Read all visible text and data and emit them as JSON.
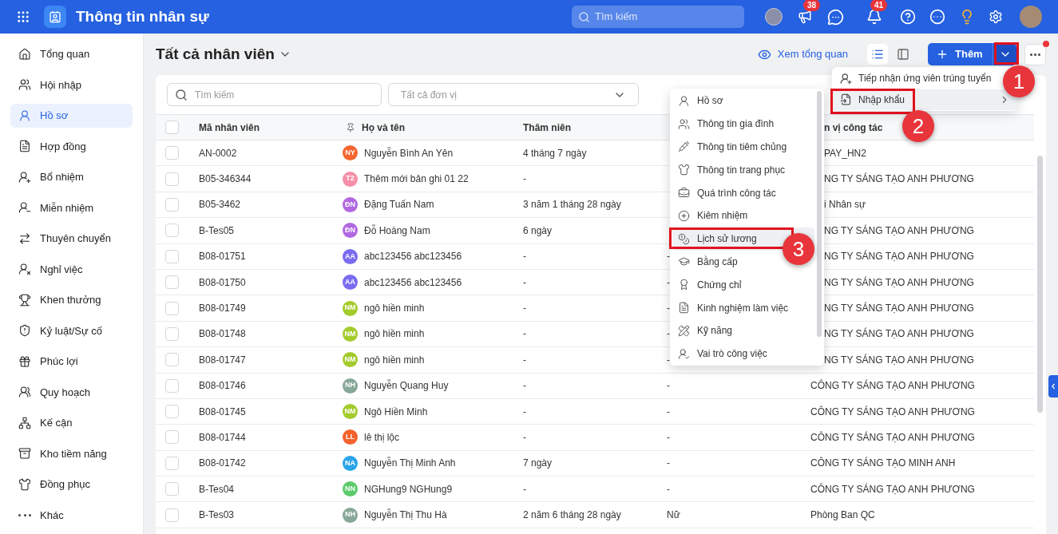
{
  "topbar": {
    "title": "Thông tin nhân sự",
    "search_placeholder": "Tìm kiếm",
    "badges": [
      {
        "count": "38"
      },
      {
        "count": "41"
      }
    ]
  },
  "sidebar": {
    "items": [
      {
        "label": "Tổng quan",
        "selected": false
      },
      {
        "label": "Hội nhập",
        "selected": false
      },
      {
        "label": "Hồ sơ",
        "selected": true
      },
      {
        "label": "Hợp đồng",
        "selected": false
      },
      {
        "label": "Bổ nhiệm",
        "selected": false
      },
      {
        "label": "Miễn nhiệm",
        "selected": false
      },
      {
        "label": "Thuyên chuyển",
        "selected": false
      },
      {
        "label": "Nghỉ việc",
        "selected": false
      },
      {
        "label": "Khen thưởng",
        "selected": false
      },
      {
        "label": "Kỷ luật/Sự cố",
        "selected": false
      },
      {
        "label": "Phúc lợi",
        "selected": false
      },
      {
        "label": "Quy hoạch",
        "selected": false
      },
      {
        "label": "Kế cận",
        "selected": false
      },
      {
        "label": "Kho tiềm năng",
        "selected": false
      },
      {
        "label": "Đồng phục",
        "selected": false
      },
      {
        "label": "Khác",
        "selected": false
      }
    ]
  },
  "header": {
    "title": "Tất cả nhân viên",
    "overview_link": "Xem tổng quan",
    "views": [
      {
        "kind": "list",
        "selected": true
      },
      {
        "kind": "panel",
        "selected": false
      }
    ],
    "add_button": "Thêm",
    "more_has_notification": true
  },
  "filters": {
    "search_placeholder": "Tìm kiếm",
    "unit_placeholder": "Tất cả đơn vị"
  },
  "table": {
    "header_checked": false,
    "columns": [
      "Mã nhân viên",
      "Họ và tên",
      "Thâm niên",
      "n vị công tác"
    ],
    "rows": [
      {
        "checked": false,
        "code": "AN-0002",
        "initials": "NY",
        "color": "#f5652f",
        "name": "Nguyễn Bình An Yên",
        "seniority": "4 tháng 7 ngày",
        "unit": "PAY_HN2"
      },
      {
        "checked": false,
        "code": "B05-346344",
        "initials": "T2",
        "color": "#f590a8",
        "name": "Thêm mới bản ghi 01 22",
        "seniority": "-",
        "unit": "NG TY SÁNG TẠO ANH PHƯƠNG"
      },
      {
        "checked": false,
        "code": "B05-3462",
        "initials": "ĐN",
        "color": "#b168e0",
        "name": "Đặng Tuấn Nam",
        "seniority": "3 năm 1 tháng 28 ngày",
        "unit": "i Nhân sự"
      },
      {
        "checked": false,
        "code": "B-Tes05",
        "initials": "ĐN",
        "color": "#b168e0",
        "name": "Đỗ Hoàng Nam",
        "seniority": "6 ngày",
        "unit": "NG TY SÁNG TẠO ANH PHƯƠNG"
      },
      {
        "checked": false,
        "code": "B08-01751",
        "initials": "AA",
        "color": "#7a6cf0",
        "name": "abc123456 abc123456",
        "seniority": "-",
        "column_4": "-",
        "unit": "NG TY SÁNG TẠO ANH PHƯƠNG"
      },
      {
        "checked": false,
        "code": "B08-01750",
        "initials": "AA",
        "color": "#7a6cf0",
        "name": "abc123456 abc123456",
        "seniority": "-",
        "column_4": "-",
        "unit": "NG TY SÁNG TẠO ANH PHƯƠNG"
      },
      {
        "checked": false,
        "code": "B08-01749",
        "initials": "NM",
        "color": "#a4cb2d",
        "name": "ngô hiền minh",
        "seniority": "-",
        "column_4": "-",
        "unit": "NG TY SÁNG TẠO ANH PHƯƠNG"
      },
      {
        "checked": false,
        "code": "B08-01748",
        "initials": "NM",
        "color": "#a4cb2d",
        "name": "ngô hiền minh",
        "seniority": "-",
        "column_4": "-",
        "unit": "NG TY SÁNG TẠO ANH PHƯƠNG"
      },
      {
        "checked": false,
        "code": "B08-01747",
        "initials": "NM",
        "color": "#a4cb2d",
        "name": "ngô hiền minh",
        "seniority": "-",
        "column_4": "-",
        "unit": "NG TY SÁNG TẠO ANH PHƯƠNG"
      },
      {
        "checked": false,
        "code": "B08-01746",
        "initials": "NH",
        "color": "#87a797",
        "name": "Nguyễn Quang Huy",
        "seniority": "-",
        "column_4": "-",
        "unit": "CÔNG TY SÁNG TẠO ANH PHƯƠNG"
      },
      {
        "checked": false,
        "code": "B08-01745",
        "initials": "NM",
        "color": "#a4cb2d",
        "name": "Ngô Hiền Minh",
        "seniority": "-",
        "column_4": "-",
        "unit": "CÔNG TY SÁNG TẠO ANH PHƯƠNG"
      },
      {
        "checked": false,
        "code": "B08-01744",
        "initials": "LL",
        "color": "#f4622c",
        "name": "lê thị lộc",
        "seniority": "-",
        "column_4": "-",
        "unit": "CÔNG TY SÁNG TẠO ANH PHƯƠNG"
      },
      {
        "checked": false,
        "code": "B08-01742",
        "initials": "NA",
        "color": "#2aa4e8",
        "name": "Nguyễn Thị Minh Anh",
        "seniority": "7 ngày",
        "column_4": "-",
        "unit": "CÔNG TY SÁNG TẠO MINH ANH"
      },
      {
        "checked": false,
        "code": "B-Tes04",
        "initials": "NN",
        "color": "#5ccb69",
        "name": "NGHung9 NGHung9",
        "seniority": "-",
        "column_4": "-",
        "unit": "CÔNG TY SÁNG TẠO ANH PHƯƠNG"
      },
      {
        "checked": false,
        "code": "B-Tes03",
        "initials": "NH",
        "color": "#87a797",
        "name": "Nguyễn Thị Thu Hà",
        "seniority": "2 năm 6 tháng 28 ngày",
        "column_4": "Nữ",
        "unit": "Phòng Ban QC"
      }
    ]
  },
  "add_menu": {
    "items": [
      {
        "label": "Tiếp nhận ứng viên trúng tuyển",
        "selected": false
      },
      {
        "label": "Nhập khẩu",
        "selected": true,
        "has_submenu": true
      }
    ]
  },
  "import_menu": {
    "items": [
      {
        "label": "Hồ sơ",
        "selected": false
      },
      {
        "label": "Thông tin gia đình",
        "selected": false
      },
      {
        "label": "Thông tin tiêm chủng",
        "selected": false
      },
      {
        "label": "Thông tin trang phục",
        "selected": false
      },
      {
        "label": "Quá trình công tác",
        "selected": false
      },
      {
        "label": "Kiêm nhiệm",
        "selected": false
      },
      {
        "label": "Lịch sử lương",
        "selected": true
      },
      {
        "label": "Bằng cấp",
        "selected": false
      },
      {
        "label": "Chứng chỉ",
        "selected": false
      },
      {
        "label": "Kinh nghiệm làm việc",
        "selected": false
      },
      {
        "label": "Kỹ năng",
        "selected": false
      },
      {
        "label": "Vai trò công việc",
        "selected": false
      }
    ]
  },
  "annotations": [
    {
      "label": "1"
    },
    {
      "label": "2"
    },
    {
      "label": "3"
    }
  ]
}
